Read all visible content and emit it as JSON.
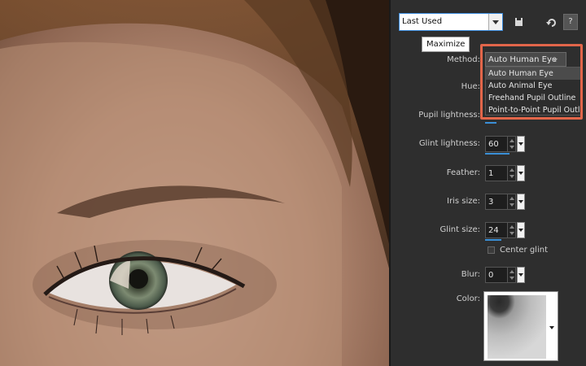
{
  "toolbar": {
    "preset_value": "Last Used",
    "tooltip": "Maximize",
    "help_label": "?"
  },
  "method": {
    "label": "Method:",
    "selected": "Auto Human Eye",
    "options": [
      "Auto Human Eye",
      "Auto Animal Eye",
      "Freehand Pupil Outline",
      "Point-to-Point Pupil Outline"
    ]
  },
  "fields": {
    "hue_label": "Hue:",
    "pupil_lightness_label": "Pupil lightness:",
    "glint_lightness": {
      "label": "Glint lightness:",
      "value": "60"
    },
    "feather": {
      "label": "Feather:",
      "value": "1"
    },
    "iris_size": {
      "label": "Iris size:",
      "value": "3"
    },
    "glint_size": {
      "label": "Glint size:",
      "value": "24"
    },
    "center_glint_label": "Center glint",
    "blur": {
      "label": "Blur:",
      "value": "0"
    },
    "color_label": "Color:"
  },
  "colors": {
    "accent_blue": "#3a8fd6",
    "highlight": "#e2664a",
    "panel_bg": "#2e2e2e"
  }
}
